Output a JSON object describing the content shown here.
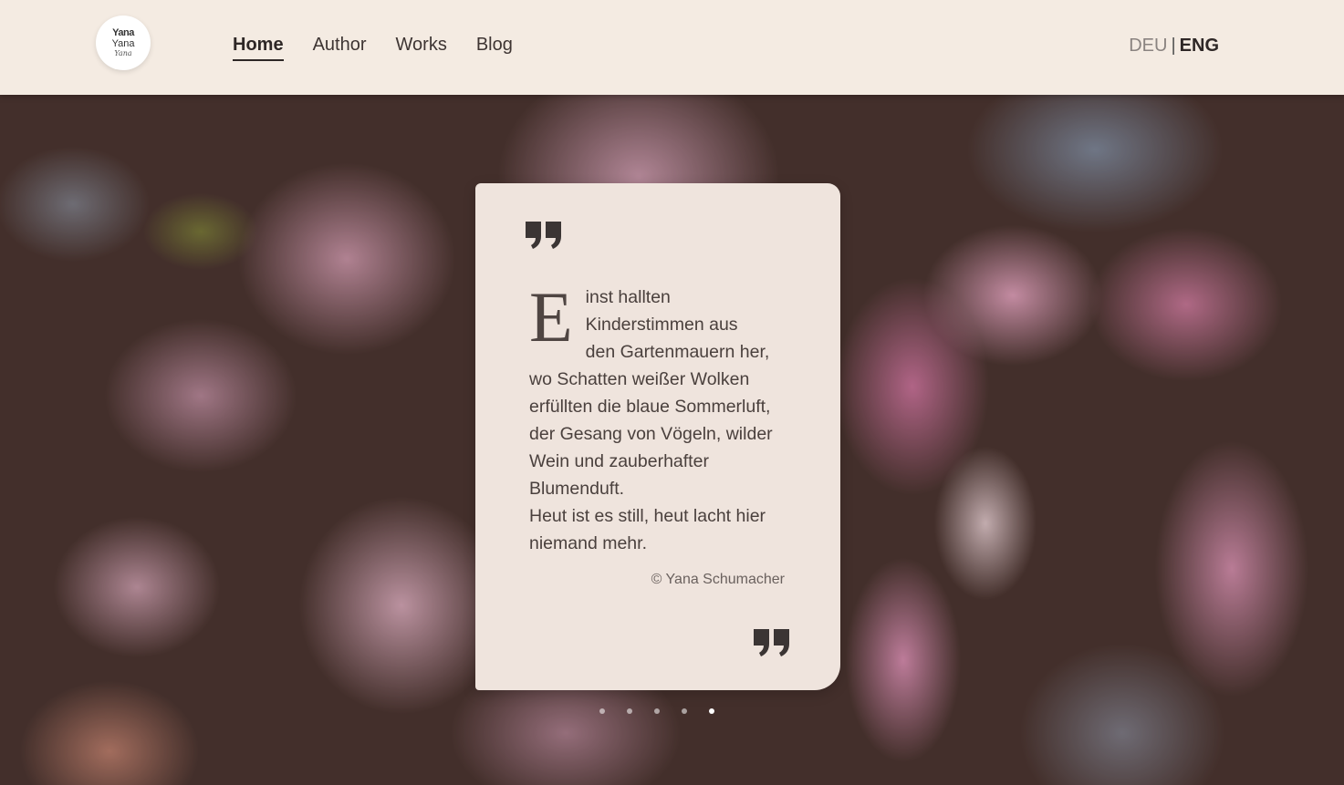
{
  "logo": {
    "line1": "Yana",
    "line2": "Yana",
    "line3": "Yana"
  },
  "nav": {
    "items": [
      {
        "label": "Home",
        "active": true
      },
      {
        "label": "Author",
        "active": false
      },
      {
        "label": "Works",
        "active": false
      },
      {
        "label": "Blog",
        "active": false
      }
    ]
  },
  "language": {
    "inactive": "DEU",
    "separator": "|",
    "active": "ENG"
  },
  "quote": {
    "dropcap": "E",
    "lines": [
      "inst hallten",
      "Kinderstimmen aus",
      "den Gartenmauern her,",
      "wo Schatten weißer Wolken",
      "erfüllten die blaue Sommerluft,",
      "der Gesang von Vögeln, wilder",
      "Wein und zauberhafter",
      "Blumenduft.",
      "Heut ist es still, heut lacht hier",
      "niemand mehr."
    ],
    "signature": "© Yana Schumacher"
  },
  "slider": {
    "count": 5,
    "active_index": 4
  },
  "colors": {
    "header_bg": "#f4ebe2",
    "card_bg": "#efe4dd",
    "text_dark": "#2e2726",
    "quote_mark": "#3b3534"
  }
}
